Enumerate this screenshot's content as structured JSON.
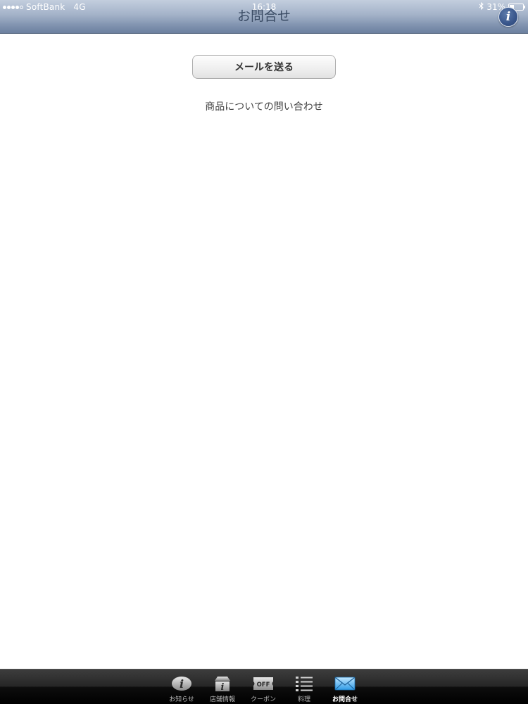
{
  "status_bar": {
    "carrier": "SoftBank",
    "network": "4G",
    "time": "16:18",
    "battery": "31%",
    "battery_level": 0.31
  },
  "nav": {
    "title": "お問合せ",
    "info_label": "i",
    "bar_color": "#8c9db6"
  },
  "content": {
    "send_button_label": "メールを送る",
    "description": "商品についての問い合わせ"
  },
  "tabbar": {
    "tabs": [
      {
        "label": "お知らせ",
        "icon": "info-icon",
        "active": false
      },
      {
        "label": "店舗情報",
        "icon": "store-info-icon",
        "active": false
      },
      {
        "label": "クーポン",
        "icon": "coupon-off-icon",
        "active": false
      },
      {
        "label": "料理",
        "icon": "list-icon",
        "active": false
      },
      {
        "label": "お問合せ",
        "icon": "mail-icon",
        "active": true
      }
    ],
    "coupon_icon_text": "OFF"
  }
}
